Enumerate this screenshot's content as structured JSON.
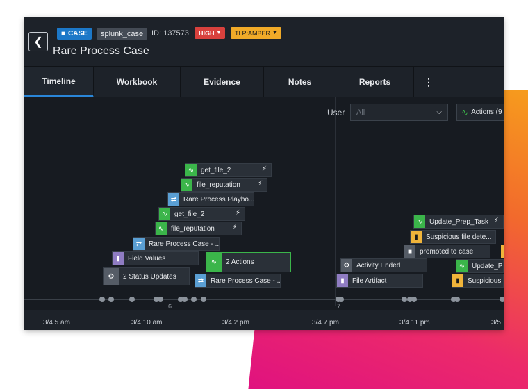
{
  "header": {
    "back_icon": "chevron-left-icon",
    "case_badge": "CASE",
    "source_badge": "splunk_case",
    "case_id": "ID: 137573",
    "severity": "HIGH",
    "tlp": "TLP:AMBER",
    "title": "Rare Process Case",
    "colors": {
      "case": "#1c78c8",
      "severity": "#d8413d",
      "tlp": "#f0aa28"
    }
  },
  "tabs": [
    {
      "label": "Timeline",
      "active": true
    },
    {
      "label": "Workbook"
    },
    {
      "label": "Evidence"
    },
    {
      "label": "Notes"
    },
    {
      "label": "Reports"
    }
  ],
  "tab_more_icon": "kebab-menu-icon",
  "filters": {
    "user_label": "User",
    "user_value": "All",
    "actions_label": "Actions (9"
  },
  "events": [
    {
      "label": "get_file_2",
      "icon": "action-pulse-icon"
    },
    {
      "label": "file_reputation",
      "icon": "action-pulse-icon"
    },
    {
      "label": "Rare Process Playbo...",
      "icon": "workflow-icon"
    },
    {
      "label": "get_file_2",
      "icon": "action-pulse-icon"
    },
    {
      "label": "file_reputation",
      "icon": "action-pulse-icon"
    },
    {
      "label": "Rare Process Case - ...",
      "icon": "workflow-icon"
    },
    {
      "label": "Field Values",
      "icon": "document-icon"
    },
    {
      "label": "2 Status Updates",
      "icon": "gear-icon"
    },
    {
      "label": "2 Actions",
      "icon": "action-pulse-icon"
    },
    {
      "label": "Rare Process Case - ...",
      "icon": "workflow-icon"
    },
    {
      "label": "Activity Ended",
      "icon": "gear-icon"
    },
    {
      "label": "File Artifact",
      "icon": "document-icon"
    },
    {
      "label": "Update_Prep_Task",
      "icon": "action-pulse-icon"
    },
    {
      "label": "Suspicious file dete...",
      "icon": "file-icon"
    },
    {
      "label": "promoted to case",
      "icon": "briefcase-icon"
    },
    {
      "label": "Update_Pr",
      "icon": "action-pulse-icon"
    },
    {
      "label": "Suspicious",
      "icon": "file-icon"
    }
  ],
  "axis": {
    "counts": [
      "6",
      "7"
    ],
    "labels": [
      "3/4 5 am",
      "3/4 10 am",
      "3/4 2 pm",
      "3/4 7 pm",
      "3/4 11 pm",
      "3/5"
    ]
  }
}
